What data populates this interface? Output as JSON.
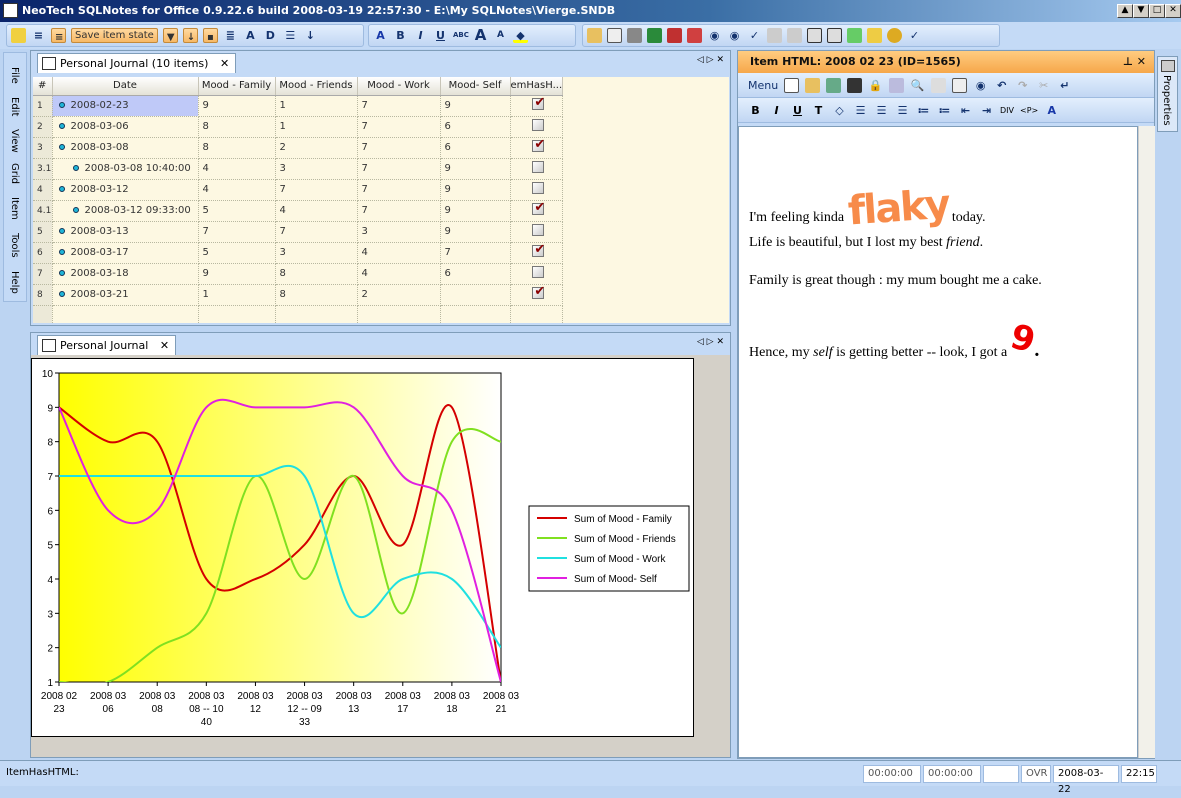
{
  "window": {
    "title": "NeoTech SQLNotes for Office 0.9.22.6 build 2008-03-19 22:57:30 - E:\\My SQLNotes\\Vierge.SNDB",
    "controls": [
      "▲",
      "▼",
      "□",
      "✕"
    ]
  },
  "toolbar": {
    "save_item_state": "Save item state",
    "bold": "B",
    "italic": "I",
    "underline": "U",
    "strike": "ABC"
  },
  "side_tabs": [
    "File",
    "Edit",
    "View",
    "Grid",
    "Item",
    "Tools",
    "Help"
  ],
  "grid_panel": {
    "tab": "Personal Journal (10 items)",
    "close": "✕",
    "columns": [
      "#",
      "Date",
      "Mood - Family",
      "Mood - Friends",
      "Mood - Work",
      "Mood- Self",
      "emHasH..."
    ],
    "rows": [
      {
        "n": "1",
        "date": "2008-02-23",
        "fam": "9",
        "fri": "1",
        "work": "7",
        "self": "9",
        "html": true,
        "sub": false
      },
      {
        "n": "2",
        "date": "2008-03-06",
        "fam": "8",
        "fri": "1",
        "work": "7",
        "self": "6",
        "html": false,
        "sub": false
      },
      {
        "n": "3",
        "date": "2008-03-08",
        "fam": "8",
        "fri": "2",
        "work": "7",
        "self": "6",
        "html": true,
        "sub": false
      },
      {
        "n": "3.1",
        "date": "2008-03-08 10:40:00",
        "fam": "4",
        "fri": "3",
        "work": "7",
        "self": "9",
        "html": false,
        "sub": true
      },
      {
        "n": "4",
        "date": "2008-03-12",
        "fam": "4",
        "fri": "7",
        "work": "7",
        "self": "9",
        "html": false,
        "sub": false
      },
      {
        "n": "4.1",
        "date": "2008-03-12 09:33:00",
        "fam": "5",
        "fri": "4",
        "work": "7",
        "self": "9",
        "html": true,
        "sub": true
      },
      {
        "n": "5",
        "date": "2008-03-13",
        "fam": "7",
        "fri": "7",
        "work": "3",
        "self": "9",
        "html": false,
        "sub": false
      },
      {
        "n": "6",
        "date": "2008-03-17",
        "fam": "5",
        "fri": "3",
        "work": "4",
        "self": "7",
        "html": true,
        "sub": false
      },
      {
        "n": "7",
        "date": "2008-03-18",
        "fam": "9",
        "fri": "8",
        "work": "4",
        "self": "6",
        "html": false,
        "sub": false
      },
      {
        "n": "8",
        "date": "2008-03-21",
        "fam": "1",
        "fri": "8",
        "work": "2",
        "self": "",
        "html": true,
        "sub": false
      }
    ]
  },
  "chart_panel": {
    "tab": "Personal Journal",
    "close": "✕"
  },
  "chart_data": {
    "type": "line",
    "smooth": true,
    "categories": [
      "2008 02 23",
      "2008 03 06",
      "2008 03 08",
      "2008 03 08 -- 10 40",
      "2008 03 12",
      "2008 03 12 -- 09 33",
      "2008 03 13",
      "2008 03 17",
      "2008 03 18",
      "2008 03 21"
    ],
    "ylim": [
      1,
      10
    ],
    "yticks": [
      1,
      2,
      3,
      4,
      5,
      6,
      7,
      8,
      9,
      10
    ],
    "legend": "right",
    "series": [
      {
        "name": "Sum of Mood - Family",
        "color": "#d40000",
        "values": [
          9,
          8,
          8,
          4,
          4,
          5,
          7,
          5,
          9,
          1
        ]
      },
      {
        "name": "Sum of Mood - Friends",
        "color": "#80e020",
        "values": [
          1,
          1,
          2,
          3,
          7,
          4,
          7,
          3,
          8,
          8
        ]
      },
      {
        "name": "Sum of Mood - Work",
        "color": "#20e0e0",
        "values": [
          7,
          7,
          7,
          7,
          7,
          7,
          3,
          4,
          4,
          2
        ]
      },
      {
        "name": "Sum of Mood- Self",
        "color": "#e020e0",
        "values": [
          9,
          6,
          6,
          9,
          9,
          9,
          9,
          7,
          6,
          1
        ]
      }
    ]
  },
  "item_panel": {
    "title": "Item HTML: 2008 02 23 (ID=1565)",
    "menu": "Menu",
    "div": "DIV",
    "p": "<P>",
    "content": {
      "l1a": "I'm feeling kinda",
      "flaky": "flaky",
      "l1b": "today.",
      "l2a": "Life is beautiful, but I lost my best ",
      "l2b": "friend",
      "l2c": ".",
      "l3": "Family is great though : my mum bought me a cake.",
      "l4a": "Hence, my ",
      "l4b": "self",
      "l4c": " is getting better -- look, I got a ",
      "nine": "9",
      "l4d": "."
    }
  },
  "properties_tab": "Properties",
  "status": {
    "label": "ItemHasHTML:",
    "t1": "00:00:00",
    "t2": "00:00:00",
    "ovr": "OVR",
    "date": "2008-03-22",
    "time": "22:15"
  }
}
